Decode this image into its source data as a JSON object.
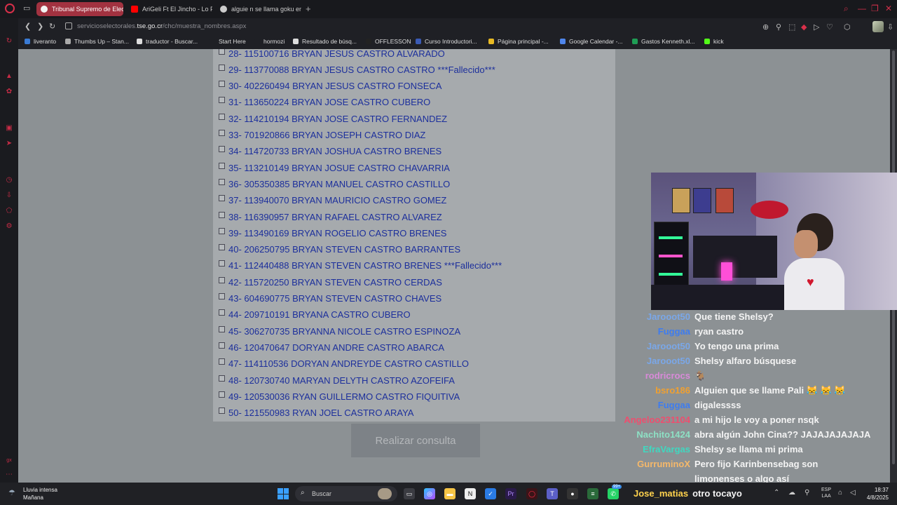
{
  "browser": {
    "tabs": [
      {
        "label": "Tribunal Supremo de Elec",
        "active": true,
        "favicon_color": "#ffffff"
      },
      {
        "label": "AriGeli Ft El Jincho - Lo P",
        "active": false,
        "favicon_color": "#ff0000"
      },
      {
        "label": "alguie n se llama goku en",
        "active": false,
        "favicon_color": "#cccccc"
      }
    ],
    "url_prefix": "servicioselectorales.",
    "url_domain": "tse.go.cr",
    "url_path": "/chc/muestra_nombres.aspx",
    "bookmarks": [
      {
        "label": "liveranto",
        "color": "#3a7bd5"
      },
      {
        "label": "Thumbs Up – Stan...",
        "color": "#aaaaaa"
      },
      {
        "label": "traductor - Buscar...",
        "color": "#dddddd"
      },
      {
        "label": "Start Here",
        "color": "#1f2025"
      },
      {
        "label": "hormozi",
        "color": "#1f2025"
      },
      {
        "label": "Resultado de búsq...",
        "color": "#dddddd"
      },
      {
        "label": "OFFLESSON",
        "color": "#222222"
      },
      {
        "label": "Curso Introductori...",
        "color": "#3b5bb5"
      },
      {
        "label": "Página principal -...",
        "color": "#e8b923"
      },
      {
        "label": "Google Calendar -...",
        "color": "#4f86ec"
      },
      {
        "label": "Gastos Kenneth.xl...",
        "color": "#1f9d55"
      },
      {
        "label": "kick",
        "color": "#53fc18"
      }
    ]
  },
  "results": [
    "28- 115100716 BRYAN JESUS CASTRO ALVARADO",
    "29- 113770088 BRYAN JESUS CASTRO CASTRO ***Fallecido***",
    "30- 402260494 BRYAN JESUS CASTRO FONSECA",
    "31- 113650224 BRYAN JOSE CASTRO CUBERO",
    "32- 114210194 BRYAN JOSE CASTRO FERNANDEZ",
    "33- 701920866 BRYAN JOSEPH CASTRO DIAZ",
    "34- 114720733 BRYAN JOSHUA CASTRO BRENES",
    "35- 113210149 BRYAN JOSUE CASTRO CHAVARRIA",
    "36- 305350385 BRYAN MANUEL CASTRO CASTILLO",
    "37- 113940070 BRYAN MAURICIO CASTRO GOMEZ",
    "38- 116390957 BRYAN RAFAEL CASTRO ALVAREZ",
    "39- 113490169 BRYAN ROGELIO CASTRO BRENES",
    "40- 206250795 BRYAN STEVEN CASTRO BARRANTES",
    "41- 112440488 BRYAN STEVEN CASTRO BRENES ***Fallecido***",
    "42- 115720250 BRYAN STEVEN CASTRO CERDAS",
    "43- 604690775 BRYAN STEVEN CASTRO CHAVES",
    "44- 209710191 BRYANA CASTRO CUBERO",
    "45- 306270735 BRYANNA NICOLE CASTRO ESPINOZA",
    "46- 120470647 DORYAN ANDRE CASTRO ABARCA",
    "47- 114110536 DORYAN ANDREYDE CASTRO CASTILLO",
    "48- 120730740 MARYAN DELYTH CASTRO AZOFEIFA",
    "49- 120530036 RYAN GUILLERMO CASTRO FIQUITIVA",
    "50- 121550983 RYAN JOEL CASTRO ARAYA"
  ],
  "consult_button": "Realizar consulta",
  "chat": [
    {
      "user": "Jarooot50",
      "color": "#7aa7e8",
      "message": "Que tiene Shelsy?"
    },
    {
      "user": "Fuggaa",
      "color": "#3d7cf0",
      "message": "ryan castro"
    },
    {
      "user": "Jarooot50",
      "color": "#7aa7e8",
      "message": "Yo tengo una prima"
    },
    {
      "user": "Jarooot50",
      "color": "#7aa7e8",
      "message": "Shelsy alfaro búsquese"
    },
    {
      "user": "rodricrocs",
      "color": "#d98ad9",
      "message": "🐐"
    },
    {
      "user": "bsro186",
      "color": "#f0a030",
      "message": "Alguien que se llame Pali 😹 😹 😹"
    },
    {
      "user": "Fuggaa",
      "color": "#3d7cf0",
      "message": "digalessss"
    },
    {
      "user": "Angeloo231104",
      "color": "#ef4d6e",
      "message": "a mi hijo le voy a poner nsqk"
    },
    {
      "user": "Nachito1424",
      "color": "#8de0c4",
      "message": "abra algún John Cina?? JAJAJAJAJAJA"
    },
    {
      "user": "EfraVargas",
      "color": "#3fd8c0",
      "message": "Shelsy se llama mi prima"
    },
    {
      "user": "GurruminoX",
      "color": "#f5b86a",
      "message": "Pero fijo Karinbensebag son"
    },
    {
      "user": "",
      "color": "#ffffff",
      "message": "limonenses o algo así"
    }
  ],
  "chat_bottom": {
    "user": "Jose_matias",
    "message": "otro tocayo"
  },
  "taskbar": {
    "weather_title": "Lluvia intensa",
    "weather_sub": "Mañana",
    "search_placeholder": "Buscar",
    "lang_top": "ESP",
    "lang_bottom": "LAA",
    "time": "18:37",
    "date": "4/8/2025",
    "badge": "99+"
  }
}
